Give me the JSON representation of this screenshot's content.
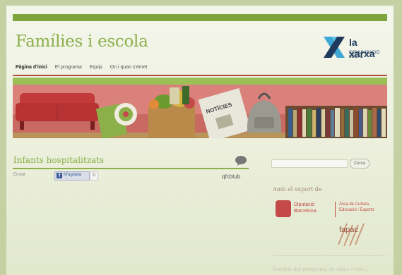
{
  "site": {
    "title": "Famílies i escola",
    "logo_name": "la xarxa",
    "logo_sub": "COMUNICACIÓ LOCAL"
  },
  "nav": {
    "items": [
      "Pàgina d'inici",
      "El programa",
      "Equip",
      "On i quan s'emet"
    ]
  },
  "banner": {
    "newspaper_label": "NOTÍCIES"
  },
  "post": {
    "title": "Infants hospitalitzats",
    "meta": "Enviat",
    "like_label": "M'agrada",
    "like_count": "0",
    "brand": "qfcbtub"
  },
  "sidebar": {
    "search_button": "Cerca",
    "support_text": "Amb el suport de",
    "diputacio_line1": "Diputació",
    "diputacio_line2": "Barcelona",
    "area_line1": "Àrea de Cultura,",
    "area_line2": "Educació i Esports",
    "fapac": "fapac",
    "footer_text": "Horaris del programa de ràdio i tele..."
  },
  "colors": {
    "accent_green": "#8bb04a",
    "nav_rule": "#b84a3a",
    "logo_navy": "#1f3a5c"
  }
}
